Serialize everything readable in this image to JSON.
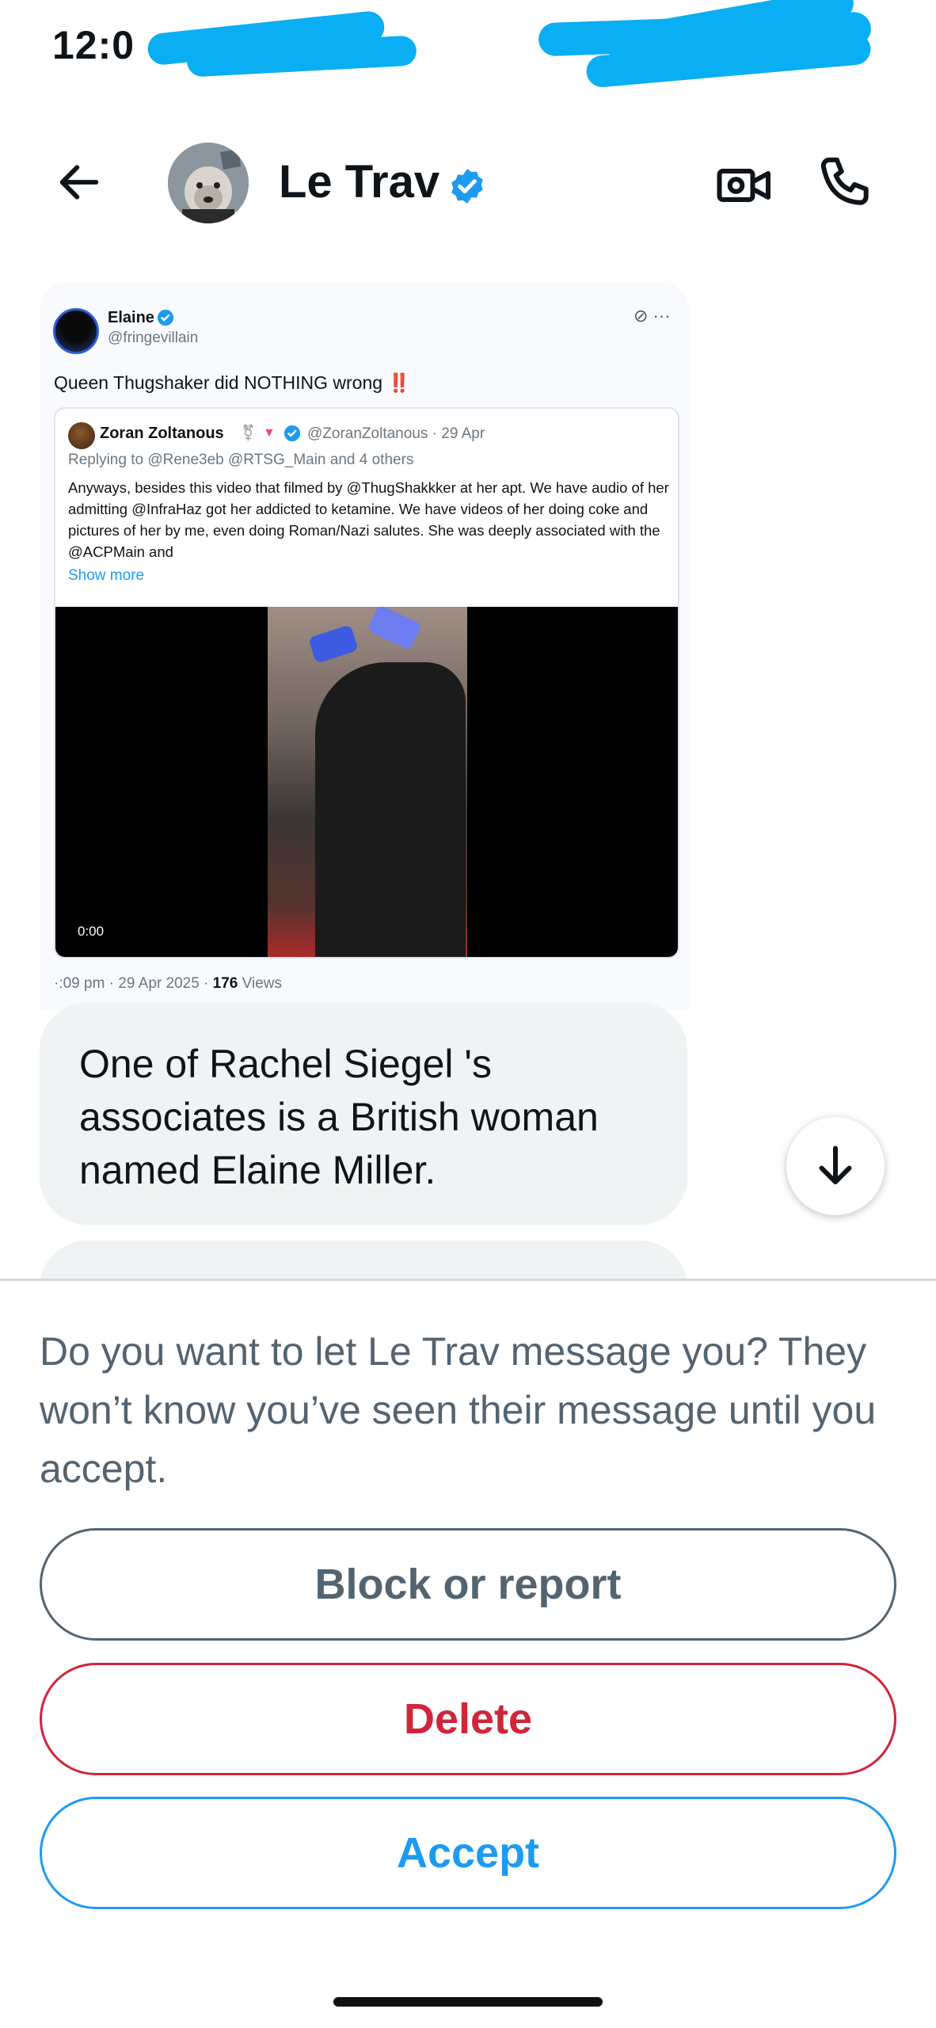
{
  "status_bar": {
    "time": "12:0"
  },
  "header": {
    "contact_name": "Le Trav",
    "verified": true,
    "icons": {
      "back": "arrow-left-icon",
      "video": "video-camera-icon",
      "call": "phone-icon"
    }
  },
  "shared_tweet": {
    "author_name": "Elaine",
    "author_handle": "@fringevillain",
    "text": "Queen Thugshaker did NOTHING wrong",
    "emphasis": "‼️",
    "tools": "⊘ ···",
    "quoted": {
      "author_name": "Zoran Zoltanous",
      "emoji": "⚧",
      "rose": "🔻",
      "handle_and_date": "@ZoranZoltanous · 29 Apr",
      "replying_to": "Replying to @Rene3eb @RTSG_Main  and 4 others",
      "body": "Anyways, besides this video that filmed by @ThugShakkker at her apt. We have audio of her admitting @InfraHaz got her addicted to ketamine. We have videos of her doing coke and pictures of her by me, even doing Roman/Nazi salutes. She was deeply associated with the @ACPMain  and",
      "show_more": "Show more",
      "video_time": "0:00"
    },
    "footer_time": "·:09 pm · 29 Apr 2025 · ",
    "footer_views_count": "176",
    "footer_views_label": " Views"
  },
  "messages": [
    {
      "text": "One of Rachel Siegel 's associates is a British woman named Elaine Miller."
    }
  ],
  "request": {
    "prompt": "Do you want to let Le Trav message you? They won’t know you’ve seen their message until you accept.",
    "block_label": "Block or report",
    "delete_label": "Delete",
    "accept_label": "Accept"
  },
  "colors": {
    "accent": "#1d9bf0",
    "danger": "#d0253b",
    "muted": "#536471",
    "bubble": "#eff3f4",
    "redaction": "#09aef3"
  }
}
